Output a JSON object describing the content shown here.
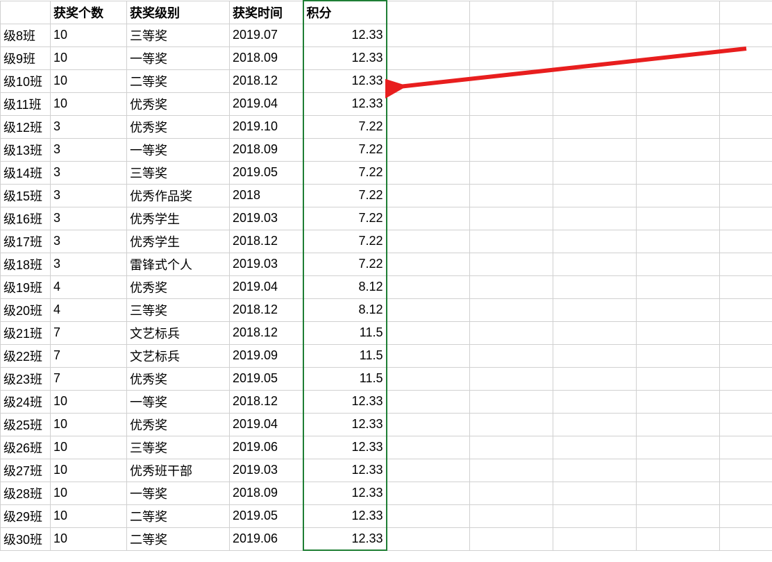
{
  "headers": {
    "col1": "获奖个数",
    "col2": "获奖级别",
    "col3": "获奖时间",
    "col4": "积分"
  },
  "rows": [
    {
      "cls": "级8班",
      "count": "10",
      "level": "三等奖",
      "time": "2019.07",
      "score": "12.33"
    },
    {
      "cls": "级9班",
      "count": "10",
      "level": "一等奖",
      "time": "2018.09",
      "score": "12.33"
    },
    {
      "cls": "级10班",
      "count": "10",
      "level": "二等奖",
      "time": "2018.12",
      "score": "12.33"
    },
    {
      "cls": "级11班",
      "count": "10",
      "level": "优秀奖",
      "time": "2019.04",
      "score": "12.33"
    },
    {
      "cls": "级12班",
      "count": "3",
      "level": "优秀奖",
      "time": "2019.10",
      "score": "7.22"
    },
    {
      "cls": "级13班",
      "count": "3",
      "level": "一等奖",
      "time": "2018.09",
      "score": "7.22"
    },
    {
      "cls": "级14班",
      "count": "3",
      "level": "三等奖",
      "time": "2019.05",
      "score": "7.22"
    },
    {
      "cls": "级15班",
      "count": "3",
      "level": "优秀作品奖",
      "time": "2018",
      "score": "7.22"
    },
    {
      "cls": "级16班",
      "count": "3",
      "level": "优秀学生",
      "time": "2019.03",
      "score": "7.22"
    },
    {
      "cls": "级17班",
      "count": "3",
      "level": "优秀学生",
      "time": "2018.12",
      "score": "7.22"
    },
    {
      "cls": "级18班",
      "count": "3",
      "level": "雷锋式个人",
      "time": "2019.03",
      "score": "7.22"
    },
    {
      "cls": "级19班",
      "count": "4",
      "level": "优秀奖",
      "time": "2019.04",
      "score": "8.12"
    },
    {
      "cls": "级20班",
      "count": "4",
      "level": "三等奖",
      "time": "2018.12",
      "score": "8.12"
    },
    {
      "cls": "级21班",
      "count": "7",
      "level": "文艺标兵",
      "time": "2018.12",
      "score": "11.5"
    },
    {
      "cls": "级22班",
      "count": "7",
      "level": "文艺标兵",
      "time": "2019.09",
      "score": "11.5"
    },
    {
      "cls": "级23班",
      "count": "7",
      "level": "优秀奖",
      "time": "2019.05",
      "score": "11.5"
    },
    {
      "cls": "级24班",
      "count": "10",
      "level": "一等奖",
      "time": "2018.12",
      "score": "12.33"
    },
    {
      "cls": "级25班",
      "count": "10",
      "level": "优秀奖",
      "time": "2019.04",
      "score": "12.33"
    },
    {
      "cls": "级26班",
      "count": "10",
      "level": "三等奖",
      "time": "2019.06",
      "score": "12.33"
    },
    {
      "cls": "级27班",
      "count": "10",
      "level": "优秀班干部",
      "time": "2019.03",
      "score": "12.33"
    },
    {
      "cls": "级28班",
      "count": "10",
      "level": "一等奖",
      "time": "2018.09",
      "score": "12.33"
    },
    {
      "cls": "级29班",
      "count": "10",
      "level": "二等奖",
      "time": "2019.05",
      "score": "12.33"
    },
    {
      "cls": "级30班",
      "count": "10",
      "level": "二等奖",
      "time": "2019.06",
      "score": "12.33"
    }
  ],
  "blank_right_cols": 5,
  "annotation": "red-arrow"
}
